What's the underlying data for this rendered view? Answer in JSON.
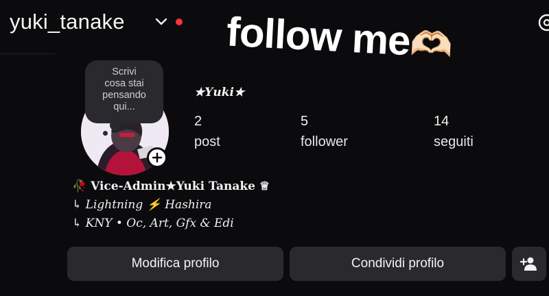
{
  "header": {
    "username": "yuki_tanake",
    "has_notification_dot": true
  },
  "sticker": {
    "text": "follow me",
    "emoji": "🫶🏻"
  },
  "note_bubble": {
    "lines": [
      "Scrivi",
      "cosa stai",
      "pensando",
      "qui..."
    ]
  },
  "profile": {
    "display_name": "★𝒀𝒖𝒌𝒊★",
    "stats": [
      {
        "value": "2",
        "label": "post"
      },
      {
        "value": "5",
        "label": "follower"
      },
      {
        "value": "14",
        "label": "seguiti"
      }
    ]
  },
  "bio": {
    "line1": "🥀 Vice-Admin★Yuki Tanake ♕",
    "line2": "↳ Lightning ⚡ Hashira",
    "line3": "↳ KNY • Oc, Art, Gfx & Edi"
  },
  "buttons": {
    "edit_profile": "Modifica profilo",
    "share_profile": "Condividi profilo"
  },
  "colors": {
    "background": "#0b0b0d",
    "button": "#2a2a2e",
    "notification_dot": "#ff3040"
  }
}
